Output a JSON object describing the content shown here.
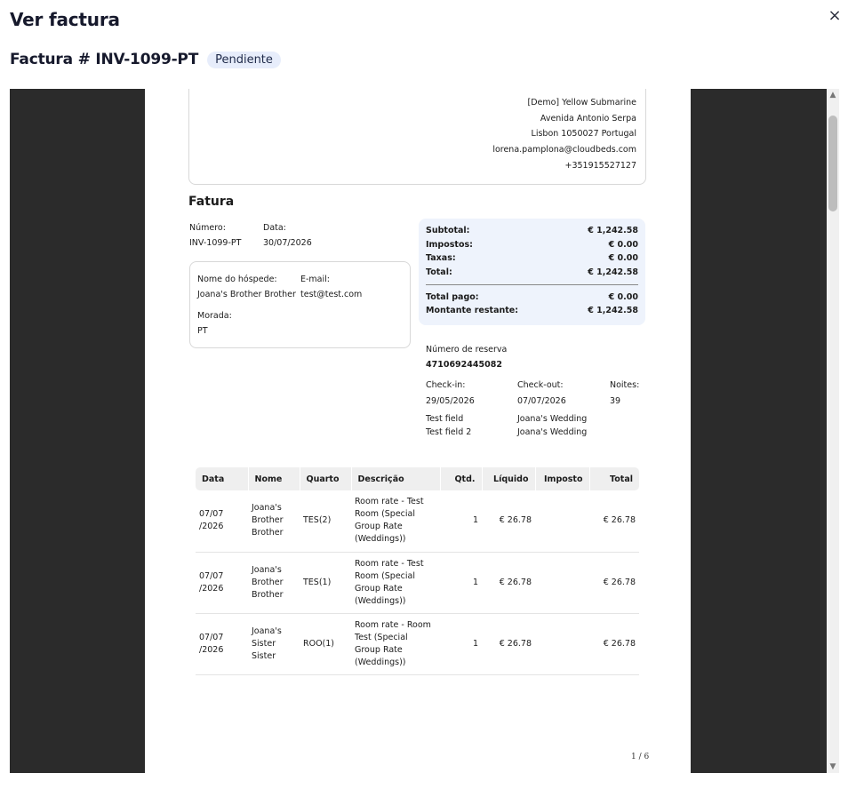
{
  "modal": {
    "title": "Ver factura",
    "close_icon": "×"
  },
  "invoice": {
    "title": "Factura # INV-1099-PT",
    "status": "Pendiente"
  },
  "hotel": {
    "name": "[Demo] Yellow Submarine",
    "address1": "Avenida Antonio Serpa",
    "address2": "Lisbon 1050027 Portugal",
    "email": "lorena.pamplona@cloudbeds.com",
    "phone": "+351915527127"
  },
  "doc": {
    "title": "Fatura",
    "numero_label": "Número:",
    "numero_value": "INV-1099-PT",
    "data_label": "Data:",
    "data_value": "30/07/2026"
  },
  "guest": {
    "name_label": "Nome do hóspede:",
    "name_value": "Joana's Brother Brother",
    "email_label": "E-mail:",
    "email_value": "test@test.com",
    "morada_label": "Morada:",
    "morada_value": "PT"
  },
  "totals": {
    "subtotal_label": "Subtotal:",
    "subtotal_value": "€ 1,242.58",
    "impostos_label": "Impostos:",
    "impostos_value": "€ 0.00",
    "taxas_label": "Taxas:",
    "taxas_value": "€ 0.00",
    "total_label": "Total:",
    "total_value": "€ 1,242.58",
    "pago_label": "Total pago:",
    "pago_value": "€ 0.00",
    "restante_label": "Montante restante:",
    "restante_value": "€ 1,242.58"
  },
  "reservation": {
    "numero_label": "Número de reserva",
    "numero_value": "4710692445082",
    "checkin_label": "Check-in:",
    "checkin_value": "29/05/2026",
    "checkout_label": "Check-out:",
    "checkout_value": "07/07/2026",
    "noites_label": "Noites:",
    "noites_value": "39",
    "field1_label": "Test field",
    "field1_value": "Joana's Wedding",
    "field2_label": "Test field 2",
    "field2_value": "Joana's Wedding"
  },
  "table": {
    "headers": [
      "Data",
      "Nome",
      "Quarto",
      "Descrição",
      "Qtd.",
      "Líquido",
      "Imposto",
      "Total"
    ],
    "rows": [
      {
        "data": "07/07\n/2026",
        "nome": "Joana's\nBrother\nBrother",
        "quarto": "TES(2)",
        "descricao": "Room rate - Test\nRoom (Special\nGroup Rate\n(Weddings))",
        "qtd": "1",
        "liquido": "€ 26.78",
        "imposto": "",
        "total": "€ 26.78"
      },
      {
        "data": "07/07\n/2026",
        "nome": "Joana's\nBrother\nBrother",
        "quarto": "TES(1)",
        "descricao": "Room rate - Test\nRoom (Special\nGroup Rate\n(Weddings))",
        "qtd": "1",
        "liquido": "€ 26.78",
        "imposto": "",
        "total": "€ 26.78"
      },
      {
        "data": "07/07\n/2026",
        "nome": "Joana's\nSister\nSister",
        "quarto": "ROO(1)",
        "descricao": "Room rate - Room\nTest (Special\nGroup Rate\n(Weddings))",
        "qtd": "1",
        "liquido": "€ 26.78",
        "imposto": "",
        "total": "€ 26.78"
      }
    ]
  },
  "pager": {
    "page_indicator": "1 / 6"
  },
  "scroll": {
    "up_icon": "▲",
    "down_icon": "▼"
  }
}
